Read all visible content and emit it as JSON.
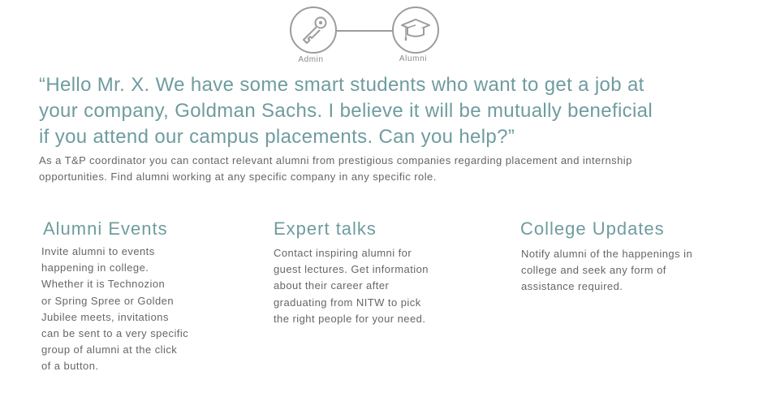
{
  "roles": {
    "admin": {
      "label": "Admin",
      "icon": "key-icon"
    },
    "alumni": {
      "label": "Alumni",
      "icon": "graduation-cap-icon"
    }
  },
  "hero": {
    "quote": "“Hello Mr. X. We have some smart students who want to get a job at your company, Goldman Sachs. I believe it will be mutually beneficial if you attend our campus placements. Can you help?”",
    "description": "As a T&P coordinator you can contact relevant alumni from prestigious companies regarding placement and internship opportunities. Find alumni working at any specific company in any specific role."
  },
  "features": [
    {
      "title": "Alumni Events",
      "lines": [
        "Invite alumni to events",
        "happening in college.",
        "Whether it is Technozion",
        "or Spring Spree or Golden",
        "Jubilee meets, invitations",
        "can be sent to a very specific",
        "group of alumni at the click",
        "of a button."
      ]
    },
    {
      "title": "Expert talks",
      "lines": [
        "Contact inspiring alumni for",
        "guest lectures. Get information",
        "about their career after",
        "graduating from NITW to pick",
        "the right people for your need."
      ]
    },
    {
      "title": "College Updates",
      "lines": [
        "Notify alumni of the happenings in",
        "college and seek any form of",
        "assistance required."
      ]
    }
  ],
  "colors": {
    "accent": "#6f9c9f",
    "text": "#666666",
    "icon_stroke": "#9c9c9c",
    "background": "#ffffff"
  }
}
